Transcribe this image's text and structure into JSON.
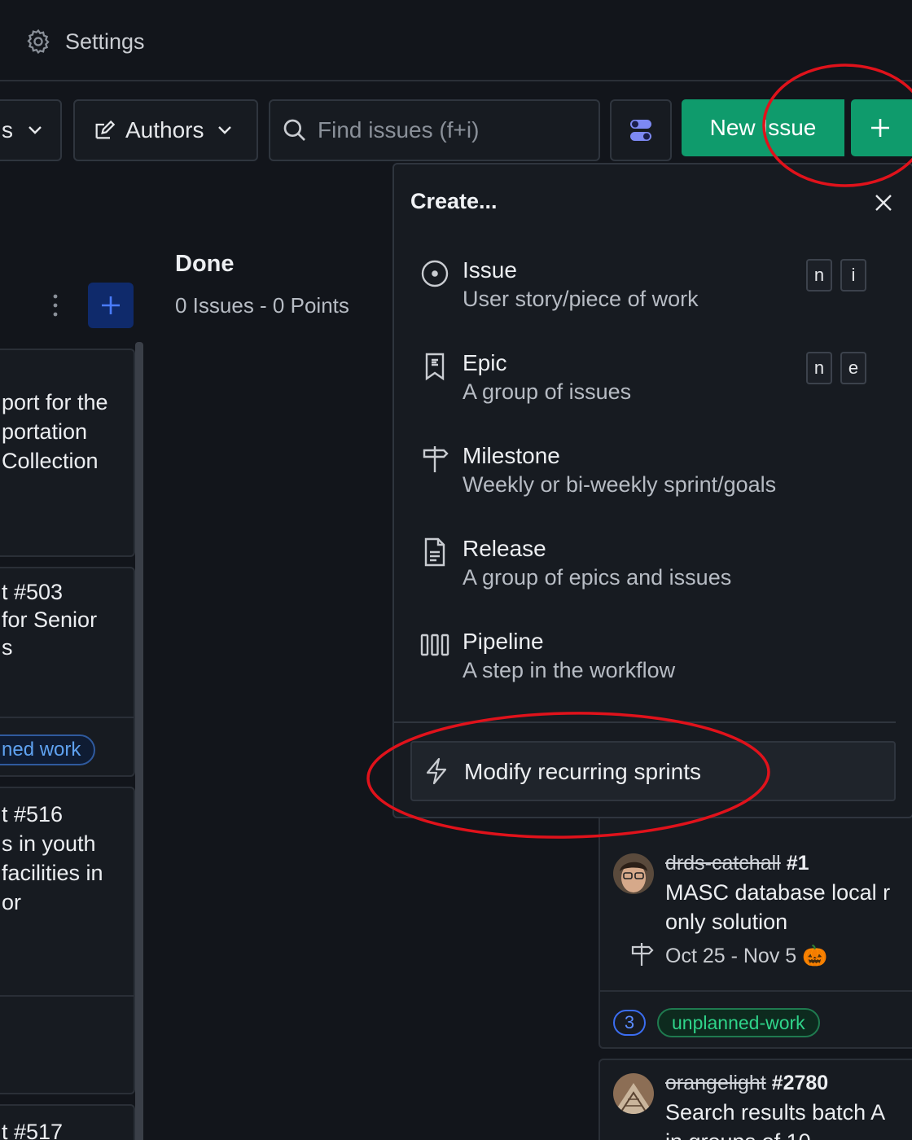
{
  "header": {
    "settings_label": "Settings"
  },
  "toolbar": {
    "filter_tail": "s",
    "authors_label": "Authors",
    "search_placeholder": "Find issues (f+i)",
    "new_issue_label": "New Issue"
  },
  "done_column": {
    "title": "Done",
    "subtitle": "0 Issues - 0 Points"
  },
  "left_cards": [
    {
      "lines": [
        "port for the",
        "portation",
        "Collection"
      ]
    },
    {
      "lines": [
        "t #503",
        "for Senior",
        "s"
      ]
    },
    {
      "badge": "ned work"
    },
    {
      "lines": [
        "t #516",
        "s in youth",
        "facilities in",
        "or"
      ]
    },
    {
      "lines": [
        "t #517"
      ]
    }
  ],
  "right_cards": [
    {
      "repo": "drds-catchall",
      "number": "#1",
      "title_lines": [
        "MASC database local r",
        "only solution"
      ],
      "milestone": "Oct 25 - Nov 5",
      "milestone_emoji": "🎃",
      "estimate": "3",
      "label": "unplanned-work"
    },
    {
      "repo": "orangelight",
      "number": "#2780",
      "title_lines": [
        "Search results batch A",
        "in groups of 10"
      ]
    }
  ],
  "create_menu": {
    "title": "Create...",
    "items": [
      {
        "icon": "issue-circle-icon",
        "title": "Issue",
        "desc": "User story/piece of work",
        "keys": [
          "n",
          "i"
        ]
      },
      {
        "icon": "epic-bookmark-icon",
        "title": "Epic",
        "desc": "A group of issues",
        "keys": [
          "n",
          "e"
        ]
      },
      {
        "icon": "milestone-signpost-icon",
        "title": "Milestone",
        "desc": "Weekly or bi-weekly sprint/goals",
        "keys": []
      },
      {
        "icon": "release-document-icon",
        "title": "Release",
        "desc": "A group of epics and issues",
        "keys": []
      },
      {
        "icon": "pipeline-columns-icon",
        "title": "Pipeline",
        "desc": "A step in the workflow",
        "keys": []
      }
    ],
    "modify_label": "Modify recurring sprints"
  },
  "colors": {
    "accent_green": "#0f9b6c",
    "accent_blue": "#3b6df0",
    "annotation_red": "#e0121b"
  }
}
